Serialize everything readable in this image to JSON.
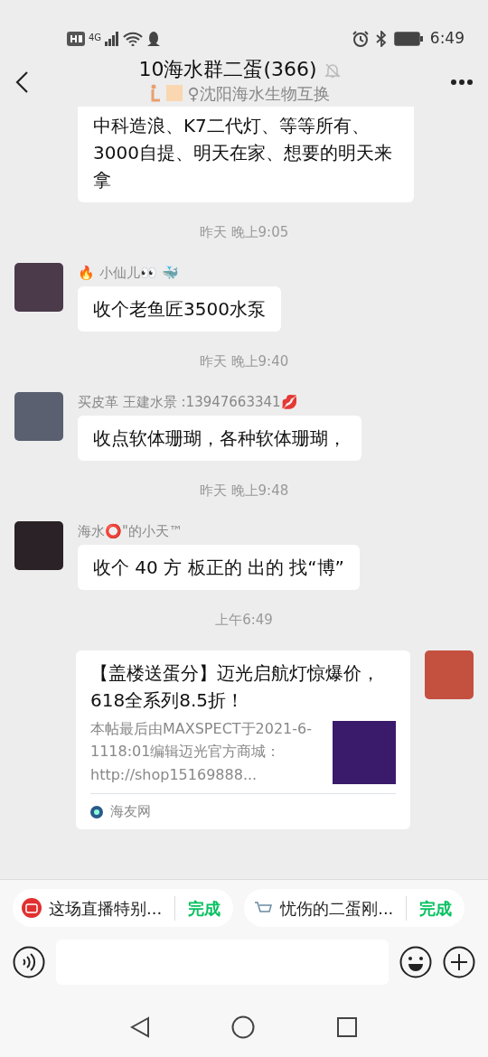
{
  "status_bar": {
    "time": "6:49",
    "network": "4G"
  },
  "header": {
    "title": "10海水群二蛋(366)",
    "muted": true,
    "subtitle": "♀沈阳海水生物互换"
  },
  "messages": [
    {
      "kind": "cut_text",
      "text": "中科造浪、K7二代灯、等等所有、3000自提、明天在家、想要的明天来拿"
    },
    {
      "kind": "time",
      "text": "昨天 晚上9:05"
    },
    {
      "kind": "text",
      "sender": "🔥 小仙儿👀 🐳",
      "text": "收个老鱼匠3500水泵"
    },
    {
      "kind": "time",
      "text": "昨天 晚上9:40"
    },
    {
      "kind": "text",
      "sender": "买皮革 王建水景 :13947663341💋",
      "text": "收点软体珊瑚，各种软体珊瑚，"
    },
    {
      "kind": "time",
      "text": "昨天 晚上9:48"
    },
    {
      "kind": "text",
      "sender": "海水⭕\"的小天™",
      "text": "收个 40 方 板正的 出的 找“博”"
    },
    {
      "kind": "time",
      "text": "上午6:49"
    },
    {
      "kind": "link",
      "title": "【盖楼送蛋分】迈光启航灯惊爆价，618全系列8.5折！",
      "description": "本帖最后由MAXSPECT于2021-6-1118:01编辑迈光官方商城：http://shop15169888...",
      "source": "海友网"
    }
  ],
  "suggestions": [
    {
      "text": "这场直播特别...",
      "action": "完成"
    },
    {
      "text": "忧伤的二蛋刚...",
      "action": "完成"
    }
  ]
}
